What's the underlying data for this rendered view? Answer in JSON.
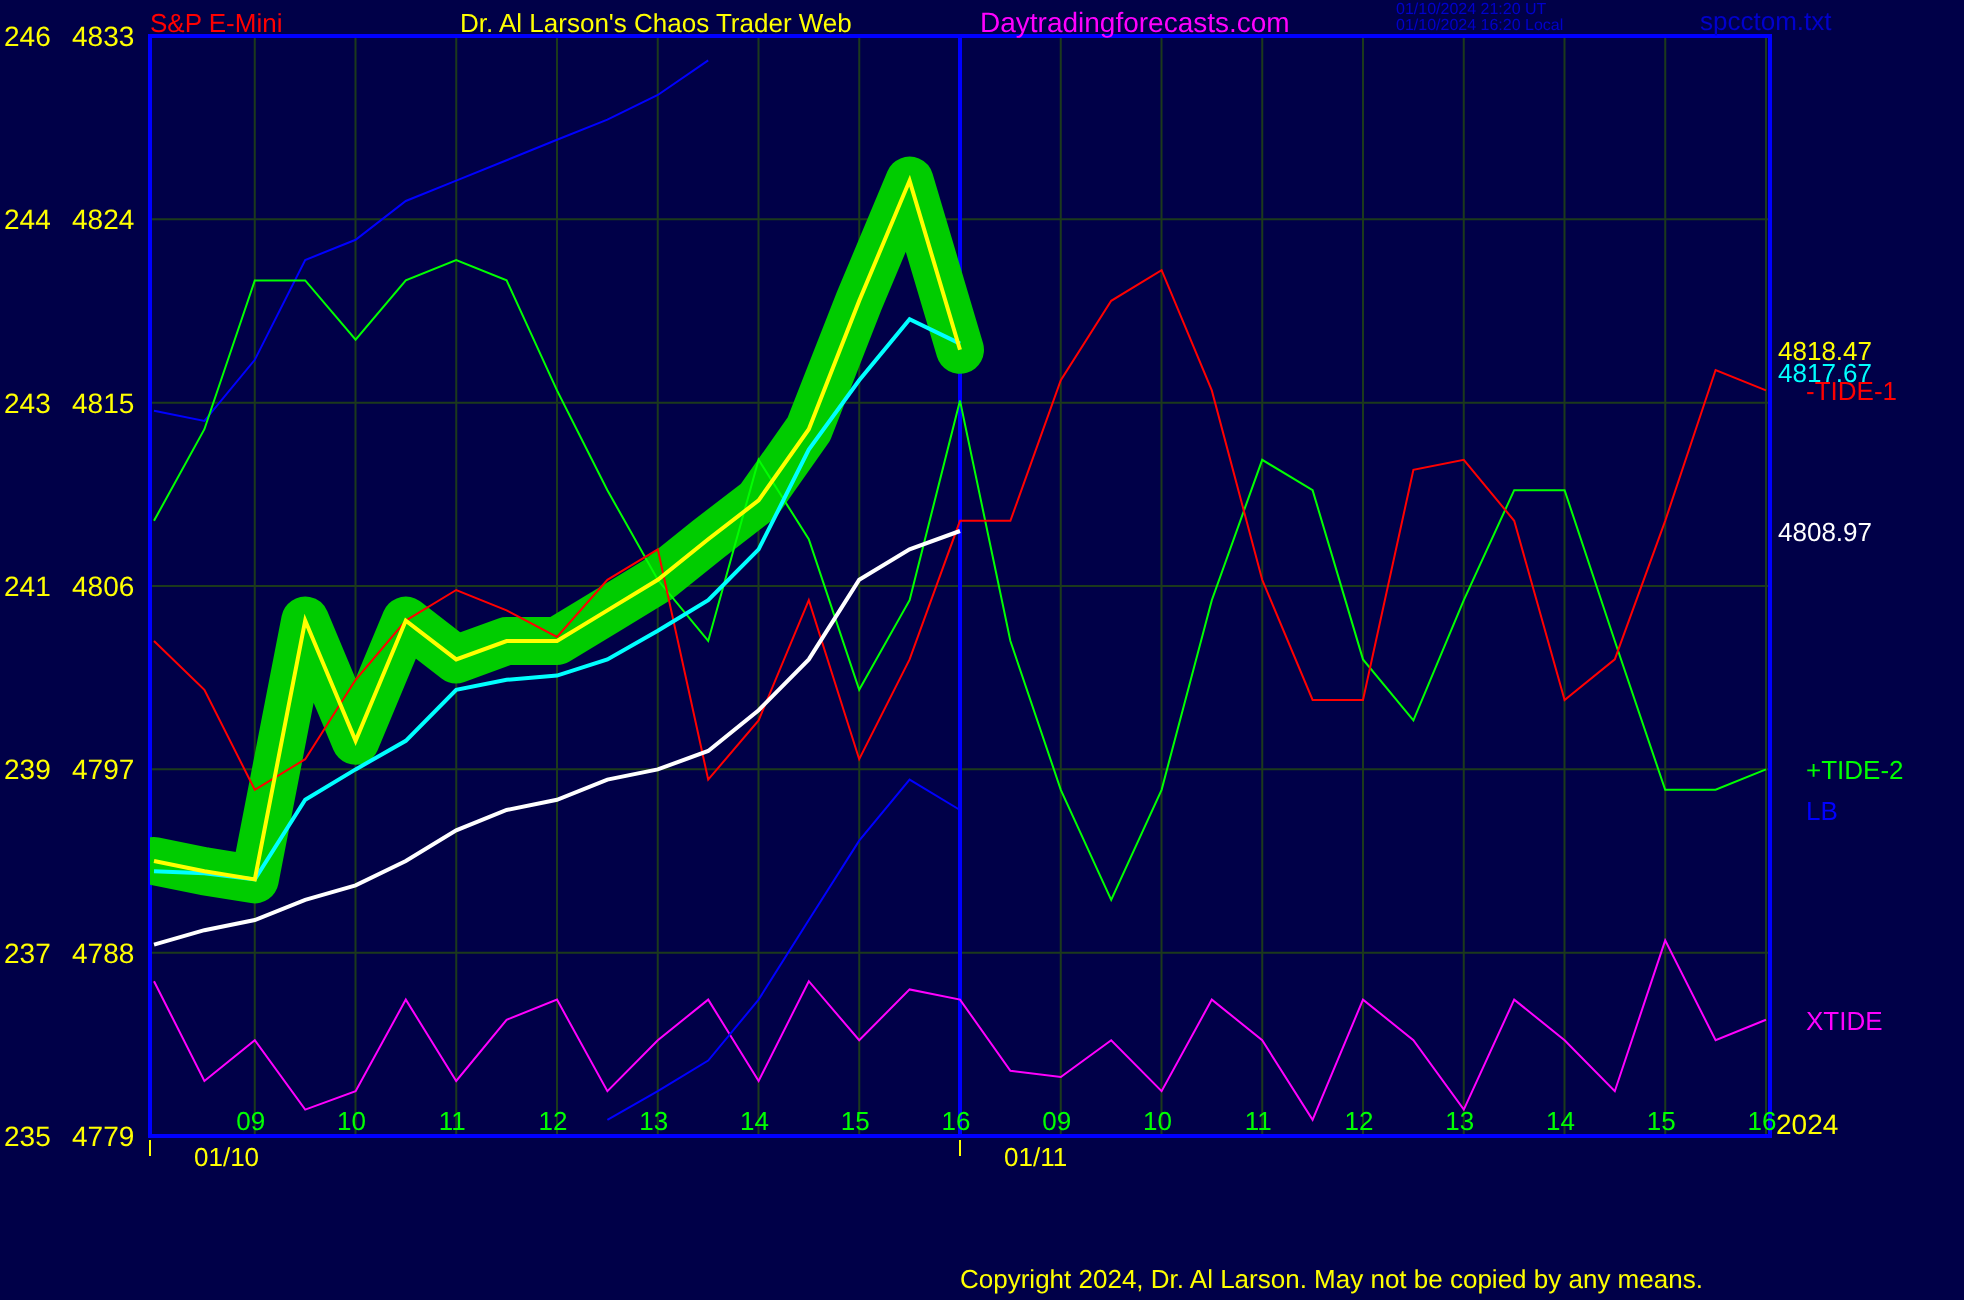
{
  "header": {
    "instrument": "S&P E-Mini",
    "title": "Dr. Al Larson's Chaos Trader Web",
    "website": "Daytradingforecasts.com",
    "time_ut": "01/10/2024 21:20 UT",
    "time_local": "01/10/2024 16:20 Local",
    "file": "spcctom.txt"
  },
  "left_scale": [
    "246",
    "244",
    "243",
    "241",
    "239",
    "237",
    "235"
  ],
  "chart_data": {
    "type": "line",
    "categories": [
      null,
      null,
      "09",
      null,
      "10",
      null,
      "11",
      null,
      "12",
      null,
      "13",
      null,
      "14",
      null,
      "15",
      null,
      "16",
      null,
      "09",
      null,
      "10",
      null,
      "11",
      null,
      "12",
      null,
      "13",
      null,
      "14",
      null,
      "15",
      null,
      "16"
    ],
    "series": [
      {
        "color": "#ffff00",
        "values": [
          4792.5,
          4792.0,
          4791.6,
          4804.3,
          4798.4,
          4804.3,
          4802.4,
          4803.3,
          4803.3,
          4804.8,
          4806.3,
          4808.3,
          4810.2,
          4813.7,
          4820.0,
          4825.9,
          4817.6,
          null,
          null,
          null,
          null,
          null,
          null,
          null,
          null,
          null,
          null,
          null,
          null,
          null,
          null,
          null,
          null
        ]
      },
      {
        "color": "#00ffff",
        "values": [
          4792.0,
          4791.9,
          4791.6,
          4795.5,
          4797.0,
          4798.4,
          4800.9,
          4801.4,
          4801.6,
          4802.4,
          4803.8,
          4805.3,
          4807.8,
          4812.7,
          4816.1,
          4819.1,
          4817.9,
          null,
          null,
          null,
          null,
          null,
          null,
          null,
          null,
          null,
          null,
          null,
          null,
          null,
          null,
          null,
          null
        ]
      },
      {
        "color": "#ffffff",
        "values": [
          4788.4,
          4789.1,
          4789.6,
          4790.6,
          4791.3,
          4792.5,
          4794.0,
          4795.0,
          4795.5,
          4796.5,
          4797.0,
          4797.9,
          4799.9,
          4802.4,
          4806.3,
          4807.8,
          4808.7,
          null,
          null,
          null,
          null,
          null,
          null,
          null,
          null,
          null,
          null,
          null,
          null,
          null,
          null,
          null,
          null
        ]
      },
      {
        "name": "-TIDE-1",
        "color": "#ff0000",
        "values": [
          4803.3,
          4800.9,
          4796.0,
          4797.5,
          4801.4,
          4804.3,
          4805.8,
          4804.8,
          4803.5,
          4806.3,
          4807.8,
          4796.5,
          4799.4,
          4805.3,
          4797.5,
          4802.4,
          4809.2,
          4809.2,
          4816.1,
          4820.0,
          4821.5,
          4815.6,
          4806.3,
          4800.4,
          4800.4,
          4811.7,
          4812.2,
          4809.2,
          4800.4,
          4802.4,
          4809.2,
          4816.6,
          4815.6
        ]
      },
      {
        "name": "+TIDE-2",
        "color": "#00ff00",
        "values": [
          4809.2,
          4813.7,
          4821.0,
          4821.0,
          4818.1,
          4821.0,
          4822.0,
          4821.0,
          4815.6,
          4810.7,
          4806.3,
          4803.3,
          4812.2,
          4808.3,
          4800.9,
          4805.3,
          4815.1,
          4803.3,
          4796.0,
          4790.6,
          4796.0,
          4805.3,
          4812.2,
          4810.7,
          4802.4,
          4799.4,
          4805.3,
          4810.7,
          4810.7,
          4803.3,
          4796.0,
          4796.0,
          4797.0
        ]
      },
      {
        "color": "#0000ff",
        "values": [
          4814.6,
          4814.1,
          4817.1,
          4822.0,
          4823.0,
          4824.9,
          4825.9,
          4826.9,
          4827.9,
          4828.9,
          4830.1,
          4831.8,
          null,
          null,
          null,
          null,
          null,
          null,
          null,
          null,
          null,
          null,
          null,
          null,
          null,
          null,
          null,
          null,
          null,
          null,
          null,
          null,
          null
        ]
      },
      {
        "name": "LB",
        "color": "#0000ff",
        "values": [
          null,
          null,
          null,
          null,
          null,
          null,
          null,
          null,
          null,
          4779.8,
          4781.2,
          4782.7,
          4785.7,
          4789.6,
          4793.5,
          4796.5,
          4795.0,
          null,
          null,
          null,
          null,
          null,
          null,
          null,
          null,
          null,
          null,
          null,
          null,
          null,
          null,
          null,
          null
        ]
      },
      {
        "name": "XTIDE",
        "color": "#ff00ff",
        "values": [
          4786.6,
          4781.7,
          4783.7,
          4780.3,
          4781.2,
          4785.7,
          4781.7,
          4784.7,
          4785.7,
          4781.2,
          4783.7,
          4785.7,
          4781.7,
          4786.6,
          4783.7,
          4786.2,
          4785.7,
          4782.2,
          4781.9,
          4783.7,
          4781.2,
          4785.7,
          4783.7,
          4779.8,
          4785.7,
          4783.7,
          4780.3,
          4785.7,
          4783.7,
          4781.2,
          4788.6,
          4783.7,
          4784.7
        ]
      }
    ],
    "ylim": [
      4779,
      4833
    ],
    "grid": true,
    "yticks": [
      4833,
      4824,
      4815,
      4806,
      4797,
      4788,
      4779
    ],
    "annotations": [
      "4818.47",
      "4817.67",
      "4808.97"
    ]
  },
  "dates": [
    "01/10",
    "01/11"
  ],
  "year": "2024",
  "copyright": "Copyright 2024, Dr. Al Larson. May not be copied by any means."
}
